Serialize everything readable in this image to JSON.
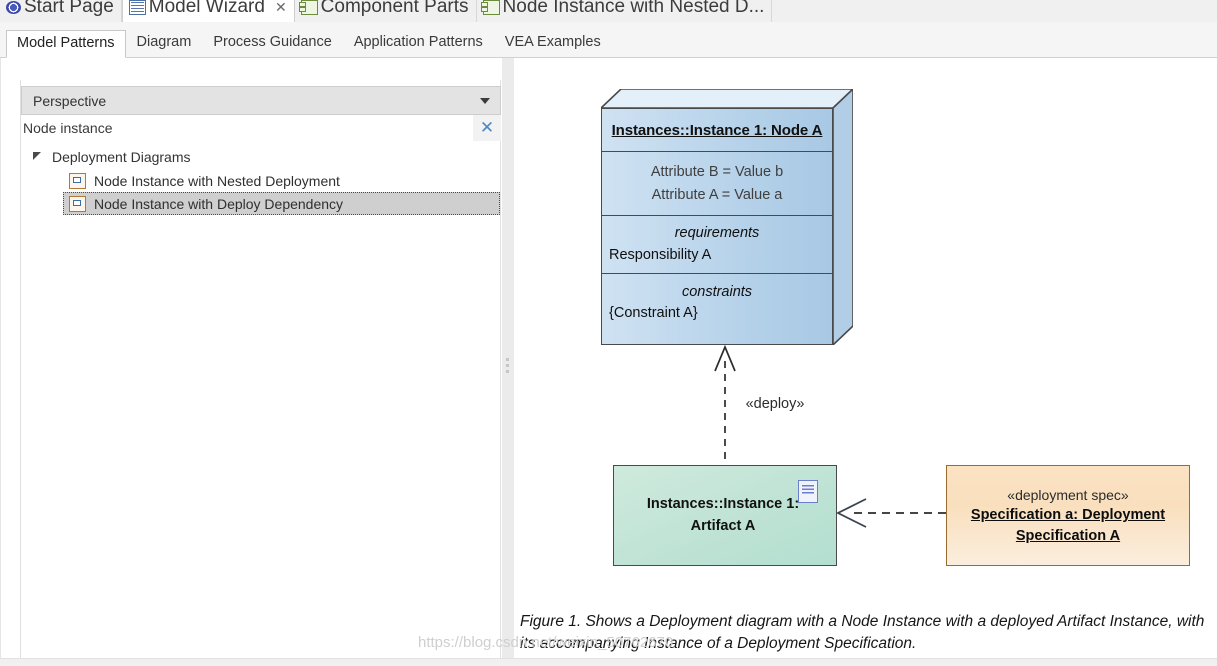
{
  "window_tabs": [
    {
      "label": "Start Page",
      "icon": "start-page-icon",
      "active": false,
      "closable": false
    },
    {
      "label": "Model Wizard",
      "icon": "document-icon",
      "active": true,
      "closable": true
    },
    {
      "label": "Component Parts",
      "icon": "component-icon",
      "active": false,
      "closable": false
    },
    {
      "label": "Node Instance with Nested D...",
      "icon": "component-icon",
      "active": false,
      "closable": false
    }
  ],
  "inner_tabs": [
    {
      "label": "Model Patterns",
      "active": true
    },
    {
      "label": "Diagram",
      "active": false
    },
    {
      "label": "Process Guidance",
      "active": false
    },
    {
      "label": "Application Patterns",
      "active": false
    },
    {
      "label": "VEA Examples",
      "active": false
    }
  ],
  "sidebar": {
    "perspective": {
      "label": "Perspective",
      "caret": "chevron-down-icon"
    },
    "filter": {
      "value": "Node instance",
      "clear_label": "✕"
    },
    "tree": {
      "group": {
        "label": "Deployment Diagrams",
        "expanded": true
      },
      "items": [
        {
          "label": "Node Instance with Nested Deployment",
          "selected": false
        },
        {
          "label": "Node Instance with Deploy Dependency",
          "selected": true
        }
      ]
    }
  },
  "diagram": {
    "node": {
      "title": "Instances::Instance 1: Node A",
      "attributes": [
        "Attribute B = Value b",
        "Attribute A = Value a"
      ],
      "sections": [
        {
          "key": "requirements",
          "value": "Responsibility A"
        },
        {
          "key": "constraints",
          "value": "{Constraint A}"
        }
      ]
    },
    "deploy_connector": {
      "label": "«deploy»"
    },
    "artifact": {
      "line1": "Instances::Instance 1:",
      "line2": "Artifact A",
      "icon": "artifact-document-icon"
    },
    "spec": {
      "stereotype": "«deployment spec»",
      "line1": "Specification a: Deployment",
      "line2": "Specification A"
    }
  },
  "caption": "Figure 1. Shows a Deployment diagram with a Node Instance with a deployed Artifact",
  "caption_line2": "Instance, with its accompanying Instance of a Deployment Specification.",
  "watermark": "https://blog.csdn.net/weixin_50762670",
  "colors": {
    "node_fill": "#bcd7ec",
    "artifact_fill": "#c3e5d6",
    "spec_fill": "#f9dfbd",
    "selection": "#cfcfcf",
    "accent_blue": "#4f86c6"
  }
}
